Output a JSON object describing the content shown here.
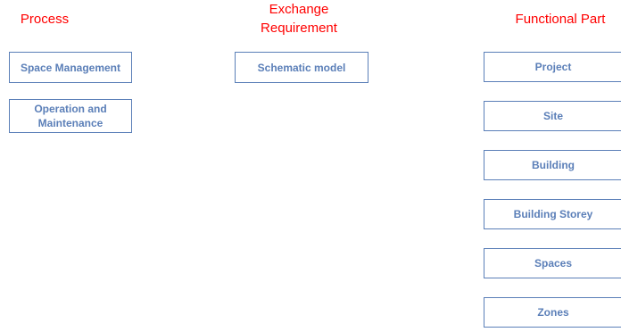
{
  "headers": {
    "process": "Process",
    "exchange_line1": "Exchange",
    "exchange_line2": "Requirement",
    "functional": "Functional Part"
  },
  "process": [
    {
      "label": "Space Management"
    },
    {
      "label_line1": "Operation and",
      "label_line2": "Maintenance"
    }
  ],
  "exchange": [
    {
      "label": "Schematic model"
    }
  ],
  "functional": [
    {
      "label": "Project"
    },
    {
      "label": "Site"
    },
    {
      "label": "Building"
    },
    {
      "label": "Building Storey"
    },
    {
      "label": "Spaces"
    },
    {
      "label": "Zones"
    }
  ],
  "colors": {
    "header_text": "#ff0000",
    "box_border": "#5b7fb8",
    "box_text": "#5b7fb8"
  }
}
